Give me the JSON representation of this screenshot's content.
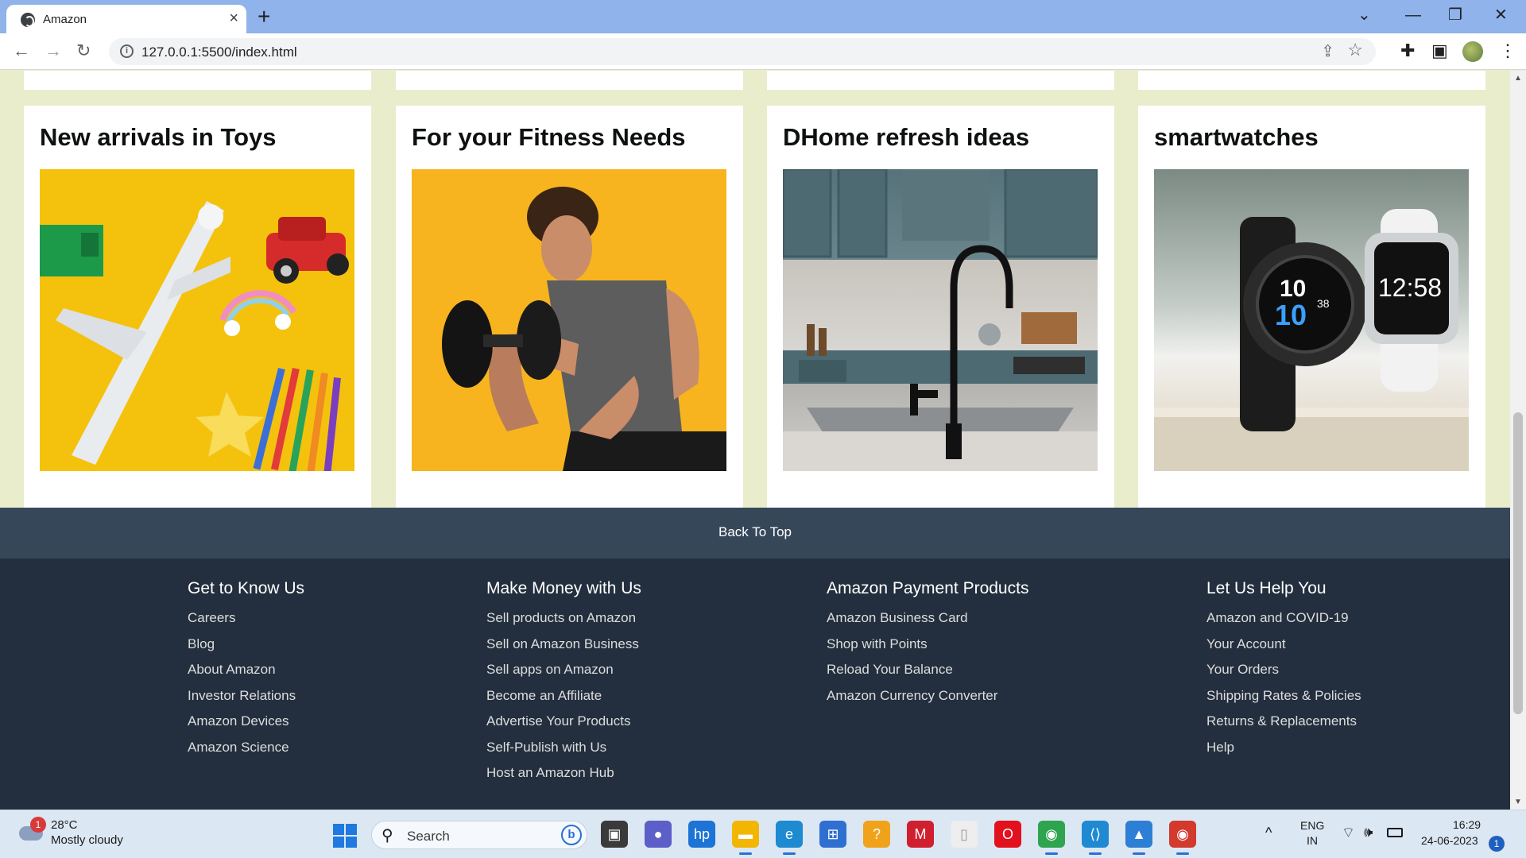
{
  "browser": {
    "tab_title": "Amazon",
    "tab_close": "×",
    "new_tab": "+",
    "url": "127.0.0.1:5500/index.html",
    "window_controls": {
      "list": "⌄",
      "minimize": "—",
      "restore": "❐",
      "close": "✕"
    },
    "nav": {
      "back": "←",
      "forward": "→",
      "reload": "↻",
      "info": "i",
      "share": "⇪",
      "star": "☆",
      "extensions": "✚",
      "sidepanel": "▣",
      "menu": "⋮"
    }
  },
  "cards": [
    {
      "title": "New arrivals in Toys",
      "image": "toys-image"
    },
    {
      "title": "For your Fitness Needs",
      "image": "fitness-image"
    },
    {
      "title": "DHome refresh ideas",
      "image": "home-image"
    },
    {
      "title": "smartwatches",
      "image": "smartwatch-image"
    }
  ],
  "watch_faces": {
    "left_time_top": "10",
    "left_time_bottom": "10",
    "left_seconds": "38",
    "right_time": "12:58"
  },
  "back_to_top": "Back To Top",
  "footer": {
    "columns": [
      {
        "heading": "Get to Know Us",
        "links": [
          "Careers",
          "Blog",
          "About Amazon",
          "Investor Relations",
          "Amazon Devices",
          "Amazon Science"
        ]
      },
      {
        "heading": "Make Money with Us",
        "links": [
          "Sell products on Amazon",
          "Sell on Amazon Business",
          "Sell apps on Amazon",
          "Become an Affiliate",
          "Advertise Your Products",
          "Self-Publish with Us",
          "Host an Amazon Hub"
        ]
      },
      {
        "heading": "Amazon Payment Products",
        "links": [
          "Amazon Business Card",
          "Shop with Points",
          "Reload Your Balance",
          "Amazon Currency Converter"
        ]
      },
      {
        "heading": "Let Us Help You",
        "links": [
          "Amazon and COVID-19",
          "Your Account",
          "Your Orders",
          "Shipping Rates & Policies",
          "Returns & Replacements",
          "Help"
        ]
      }
    ]
  },
  "taskbar": {
    "weather_badge": "1",
    "weather_temp": "28°C",
    "weather_desc": "Mostly cloudy",
    "search_label": "Search",
    "search_bing": "b",
    "apps": [
      {
        "name": "task-view",
        "glyph": "▣",
        "color": "#3a3a3a"
      },
      {
        "name": "teams",
        "glyph": "●",
        "color": "#5b5fc7"
      },
      {
        "name": "myhp",
        "glyph": "hp",
        "color": "#1e73d6"
      },
      {
        "name": "file-explorer",
        "glyph": "▬",
        "color": "#f2b600"
      },
      {
        "name": "edge",
        "glyph": "e",
        "color": "#1d8ad1"
      },
      {
        "name": "store",
        "glyph": "⊞",
        "color": "#2f6fd1"
      },
      {
        "name": "tips",
        "glyph": "?",
        "color": "#f0a31a"
      },
      {
        "name": "mcafee",
        "glyph": "M",
        "color": "#d01f2e"
      },
      {
        "name": "blank-file",
        "glyph": "▯",
        "color": "#eeeeee"
      },
      {
        "name": "opera",
        "glyph": "O",
        "color": "#e3101d"
      },
      {
        "name": "chrome",
        "glyph": "◉",
        "color": "#2ea44f"
      },
      {
        "name": "vscode",
        "glyph": "⟨⟩",
        "color": "#1f8ad2"
      },
      {
        "name": "photos",
        "glyph": "▲",
        "color": "#2d7fd6"
      },
      {
        "name": "chrome-profile",
        "glyph": "◉",
        "color": "#d23a2d"
      }
    ],
    "tray_chevron": "^",
    "lang_top": "ENG",
    "lang_bottom": "IN",
    "time": "16:29",
    "date": "24-06-2023",
    "notifications": "1"
  }
}
